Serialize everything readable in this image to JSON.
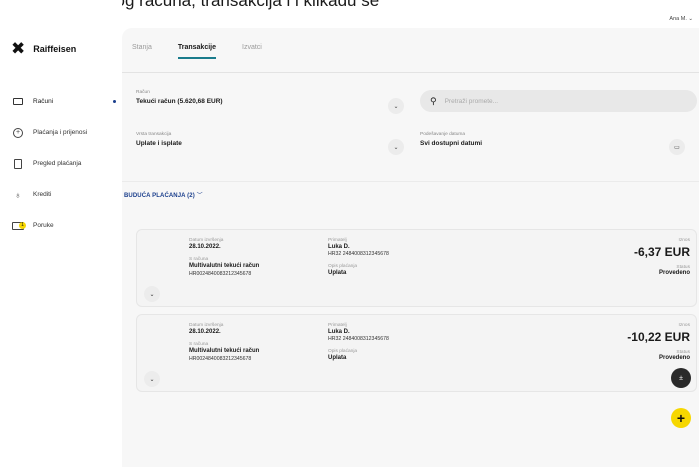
{
  "caption": "plaćena s drugog računa, transakcija i i klikadu se",
  "sidebar": {
    "brand": "Raiffeisen",
    "items": [
      {
        "label": "Računi",
        "icon": "account-card-icon",
        "active": true
      },
      {
        "label": "Plaćanja i prijenosi",
        "icon": "payments-plus-icon",
        "active": false
      },
      {
        "label": "Pregled plaćanja",
        "icon": "document-icon",
        "active": false
      },
      {
        "label": "Krediti",
        "icon": "money-bag-icon",
        "active": false
      },
      {
        "label": "Poruke",
        "icon": "envelope-icon",
        "active": false,
        "badge": "1"
      }
    ]
  },
  "header": {
    "user": "Ana M."
  },
  "tabs": [
    {
      "label": "Stanja",
      "active": false
    },
    {
      "label": "Transakcije",
      "active": true
    },
    {
      "label": "Izvatci",
      "active": false
    }
  ],
  "filters": {
    "account_label": "Račun",
    "account_value": "Tekući račun (5.620,68 EUR)",
    "type_label": "Vrsta transakcija",
    "type_value": "Uplate i isplate",
    "search_placeholder": "Pretraži promete...",
    "period_label": "Podešavanje datuma",
    "period_value": "Svi dostupni datumi"
  },
  "section": {
    "title": "BUDUĆA PLAĆANJA (2)"
  },
  "transactions": [
    {
      "date_label": "Datum izvršenja",
      "date": "28.10.2022.",
      "account_label": "S računa",
      "account_name": "Multivalutni tekući račun",
      "account_iban": "HR0024840083212345678",
      "recipient_label": "Primatelj",
      "recipient": "Luka D.",
      "recipient_iban": "HR32 2484008312345678",
      "desc_label": "Opis plaćanja",
      "desc": "Uplata",
      "amount_label": "Iznos",
      "amount": "-6,37 EUR",
      "status_label": "Status",
      "status": "Provedeno"
    },
    {
      "date_label": "Datum izvršenja",
      "date": "28.10.2022.",
      "account_label": "S računa",
      "account_name": "Multivalutni tekući račun",
      "account_iban": "HR0024840083212345678",
      "recipient_label": "Primatelj",
      "recipient": "Luka D.",
      "recipient_iban": "HR32 2484008312345678",
      "desc_label": "Opis plaćanja",
      "desc": "Uplata",
      "amount_label": "Iznos",
      "amount": "-10,22 EUR",
      "status_label": "Status",
      "status": "Provedeno"
    }
  ],
  "colors": {
    "accent": "#1a3e8c",
    "tab_underline": "#1a7c8c",
    "fab_yellow": "#f6d700"
  }
}
